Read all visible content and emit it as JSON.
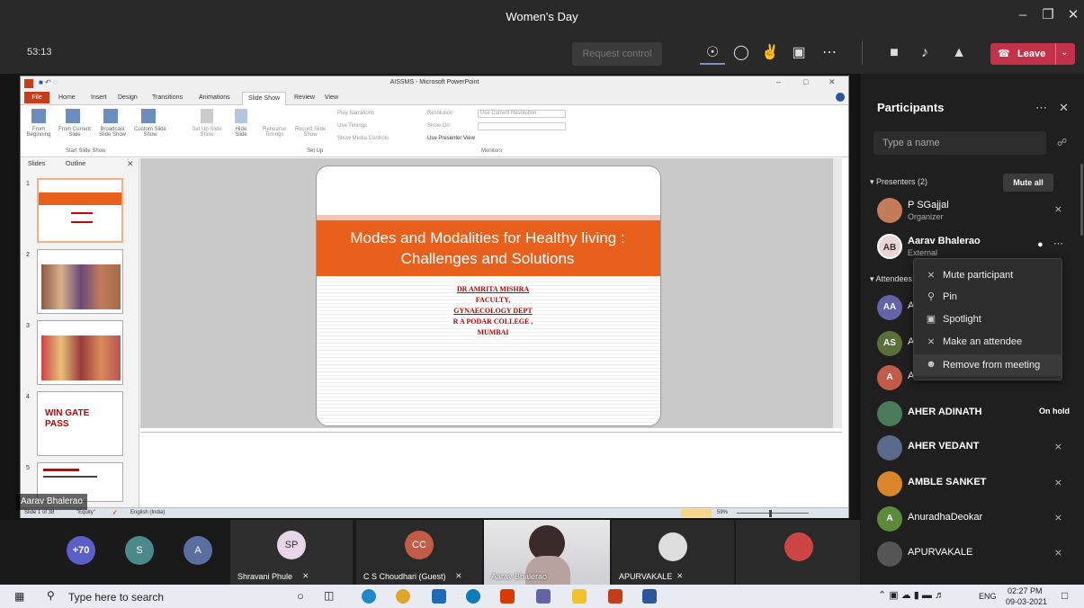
{
  "window": {
    "title": "Women's Day"
  },
  "meeting": {
    "timer": "53:13",
    "request_control": "Request control",
    "leave_label": "Leave"
  },
  "ppt": {
    "window_title": "AISSMS - Microsoft PowerPoint",
    "tabs": [
      "File",
      "Home",
      "Insert",
      "Design",
      "Transitions",
      "Animations",
      "Slide Show",
      "Review",
      "View"
    ],
    "ribbon": {
      "from_beginning": "From Beginning",
      "from_current": "From Current Slide",
      "broadcast": "Broadcast Slide Show",
      "custom": "Custom Slide Show",
      "setup_slideshow": "Set Up Slide Show",
      "hide_slide": "Hide Slide",
      "rehearse": "Rehearse Timings",
      "record": "Record Slide Show",
      "play_narrations": "Play Narrations",
      "use_timings": "Use Timings",
      "show_media": "Show Media Controls",
      "resolution": "Resolution:",
      "resolution_value": "Use Current Resolution",
      "show_on": "Show On:",
      "presenter_view": "Use Presenter View",
      "group_start": "Start Slide Show",
      "group_setup": "Set Up",
      "group_monitors": "Monitors"
    },
    "pane_tabs": [
      "Slides",
      "Outline"
    ],
    "slide_numbers": [
      "1",
      "2",
      "3",
      "4",
      "5"
    ],
    "thumb4_text": "WIN GATE PASS",
    "slide": {
      "title": "Modes and Modalities for Healthy living : Challenges and Solutions",
      "author_lines": [
        "DR AMRITA MISHRA",
        "FACULTY,",
        "GYNAECOLOGY DEPT",
        "R A PODAR COLLEGE ,",
        "MUMBAI"
      ]
    },
    "status": {
      "slide_info": "Slide 1 of 38",
      "theme": "\"Equity\"",
      "language": "English (India)",
      "zoom": "59%"
    },
    "presenter_label": "Aarav Bhalerao"
  },
  "participants": {
    "title": "Participants",
    "search_placeholder": "Type a name",
    "presenters_header": "Presenters (2)",
    "mute_all": "Mute all",
    "attendees_header": "Attendees",
    "presenters": [
      {
        "name": "P SGajjal",
        "role": "Organizer"
      },
      {
        "name": "Aarav Bhalerao",
        "role": "External",
        "initials": "AB"
      }
    ],
    "attendees": [
      {
        "name": "A",
        "initials": "AA",
        "color": "#6264a7"
      },
      {
        "name": "A",
        "initials": "AS",
        "color": "#5b6f3b"
      },
      {
        "name": "A",
        "initials": "A",
        "color": "#c25b47"
      },
      {
        "name": "AHER ADINATH",
        "status": "On hold"
      },
      {
        "name": "AHER VEDANT"
      },
      {
        "name": "AMBLE SANKET"
      },
      {
        "name": "AnuradhaDeokar",
        "initials": "A",
        "color": "#5b8a3b"
      },
      {
        "name": "APURVAKALE"
      }
    ]
  },
  "context_menu": {
    "items": [
      {
        "label": "Mute participant",
        "icon": "mic-off-icon"
      },
      {
        "label": "Pin",
        "icon": "pin-icon"
      },
      {
        "label": "Spotlight",
        "icon": "spotlight-icon"
      },
      {
        "label": "Make an attendee",
        "icon": "attendee-icon"
      },
      {
        "label": "Remove from meeting",
        "icon": "remove-person-icon"
      }
    ]
  },
  "gallery": {
    "overflow": "+70",
    "tiles": [
      {
        "initials": "S"
      },
      {
        "initials": "A"
      },
      {
        "initials": "SP",
        "name": "Shravani Phule"
      },
      {
        "initials": "CC",
        "name": "C S Choudhari (Guest)"
      },
      {
        "name": "Aarav Bhalerao"
      },
      {
        "name": "APURVAKALE"
      }
    ]
  },
  "taskbar": {
    "search_placeholder": "Type here to search",
    "lang": "ENG",
    "time": "02:27 PM",
    "date": "09-03-2021"
  }
}
